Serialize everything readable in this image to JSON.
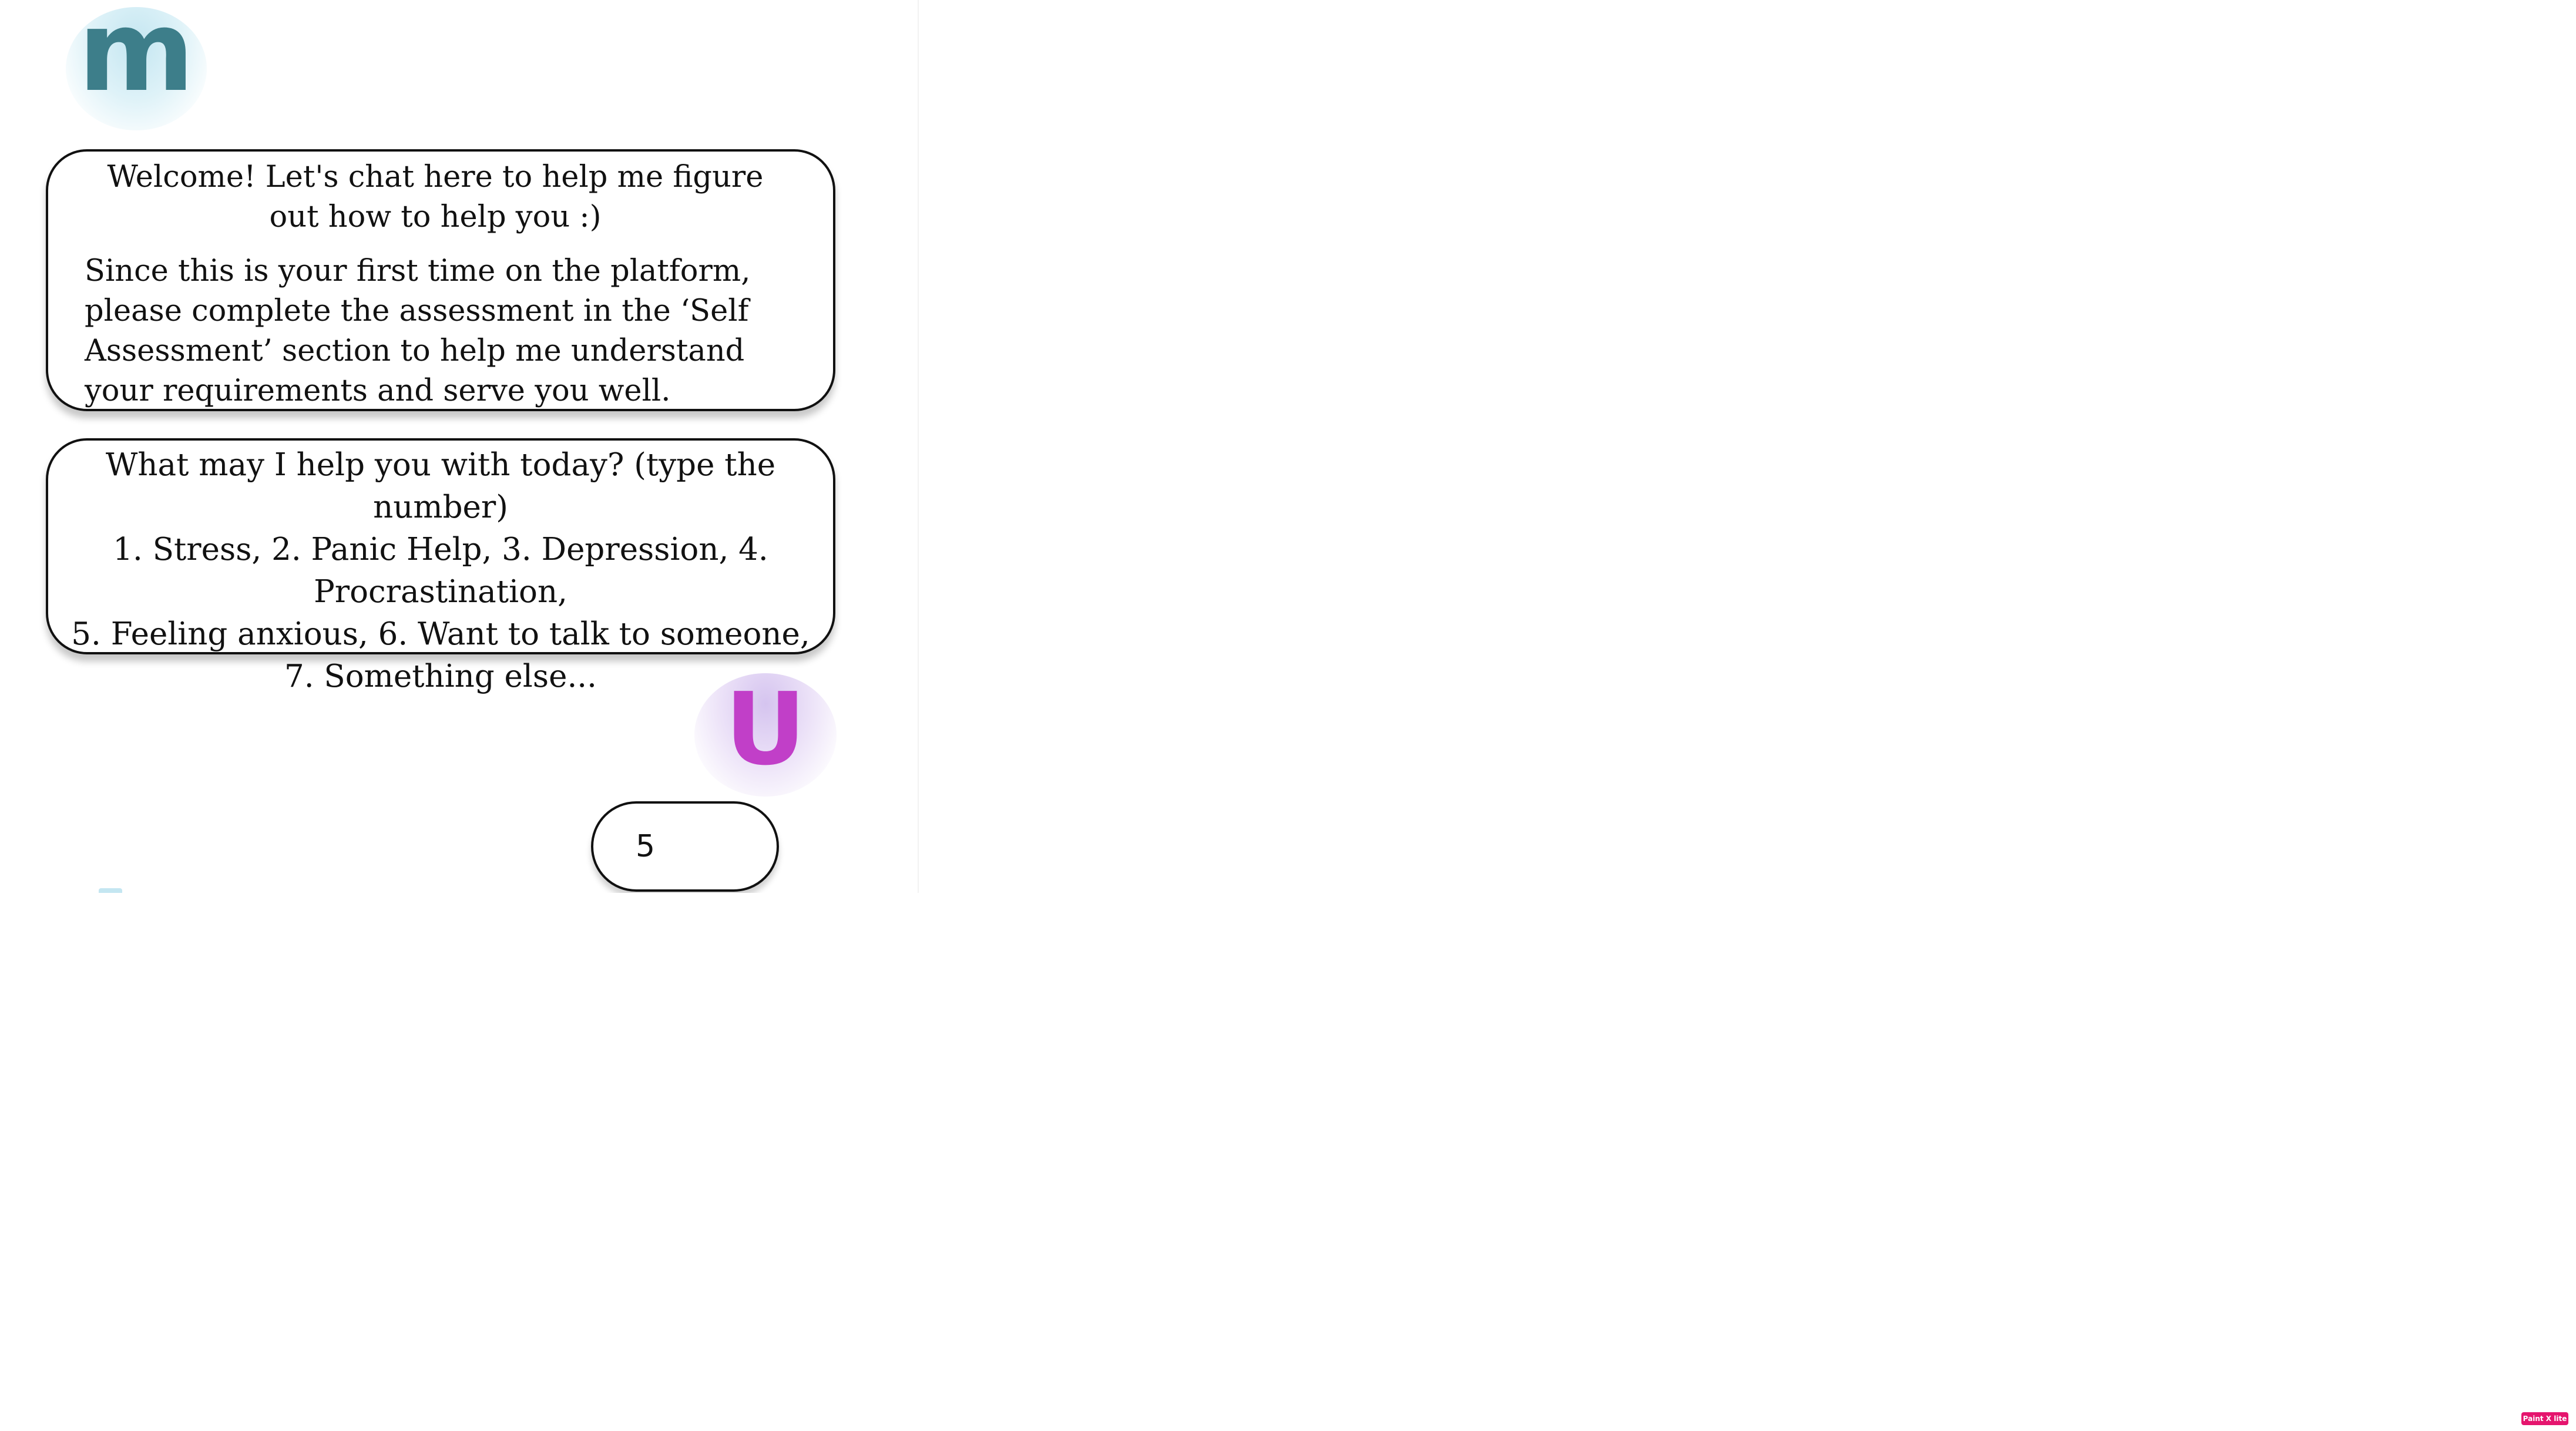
{
  "chat": {
    "bot_avatar_letter": "m",
    "user_avatar_letter": "U",
    "welcome_message": {
      "greeting": "Welcome! Let's chat here to help me figure out how to help you :)",
      "body": "Since this is your first time on the platform, please complete the assessment in the ‘Self Assessment’ section to help me understand your requirements and serve you well."
    },
    "options_message": {
      "prompt": "What may I help you with today? (type the number)",
      "line1": "1. Stress, 2. Panic Help, 3. Depression, 4. Procrastination,",
      "line2": "5. Feeling anxious, 6. Want to talk to someone, 7. Something else..."
    },
    "user_reply": "5"
  },
  "badge": {
    "label": "Paint X lite"
  },
  "colors": {
    "bot_avatar_text": "#3d7e8a",
    "bot_avatar_bg": "#c4e6f1",
    "user_avatar_text": "#c13fc8",
    "user_avatar_bg": "#d5c4ef",
    "bubble_border": "#111111",
    "badge_bg": "#e5156e"
  }
}
